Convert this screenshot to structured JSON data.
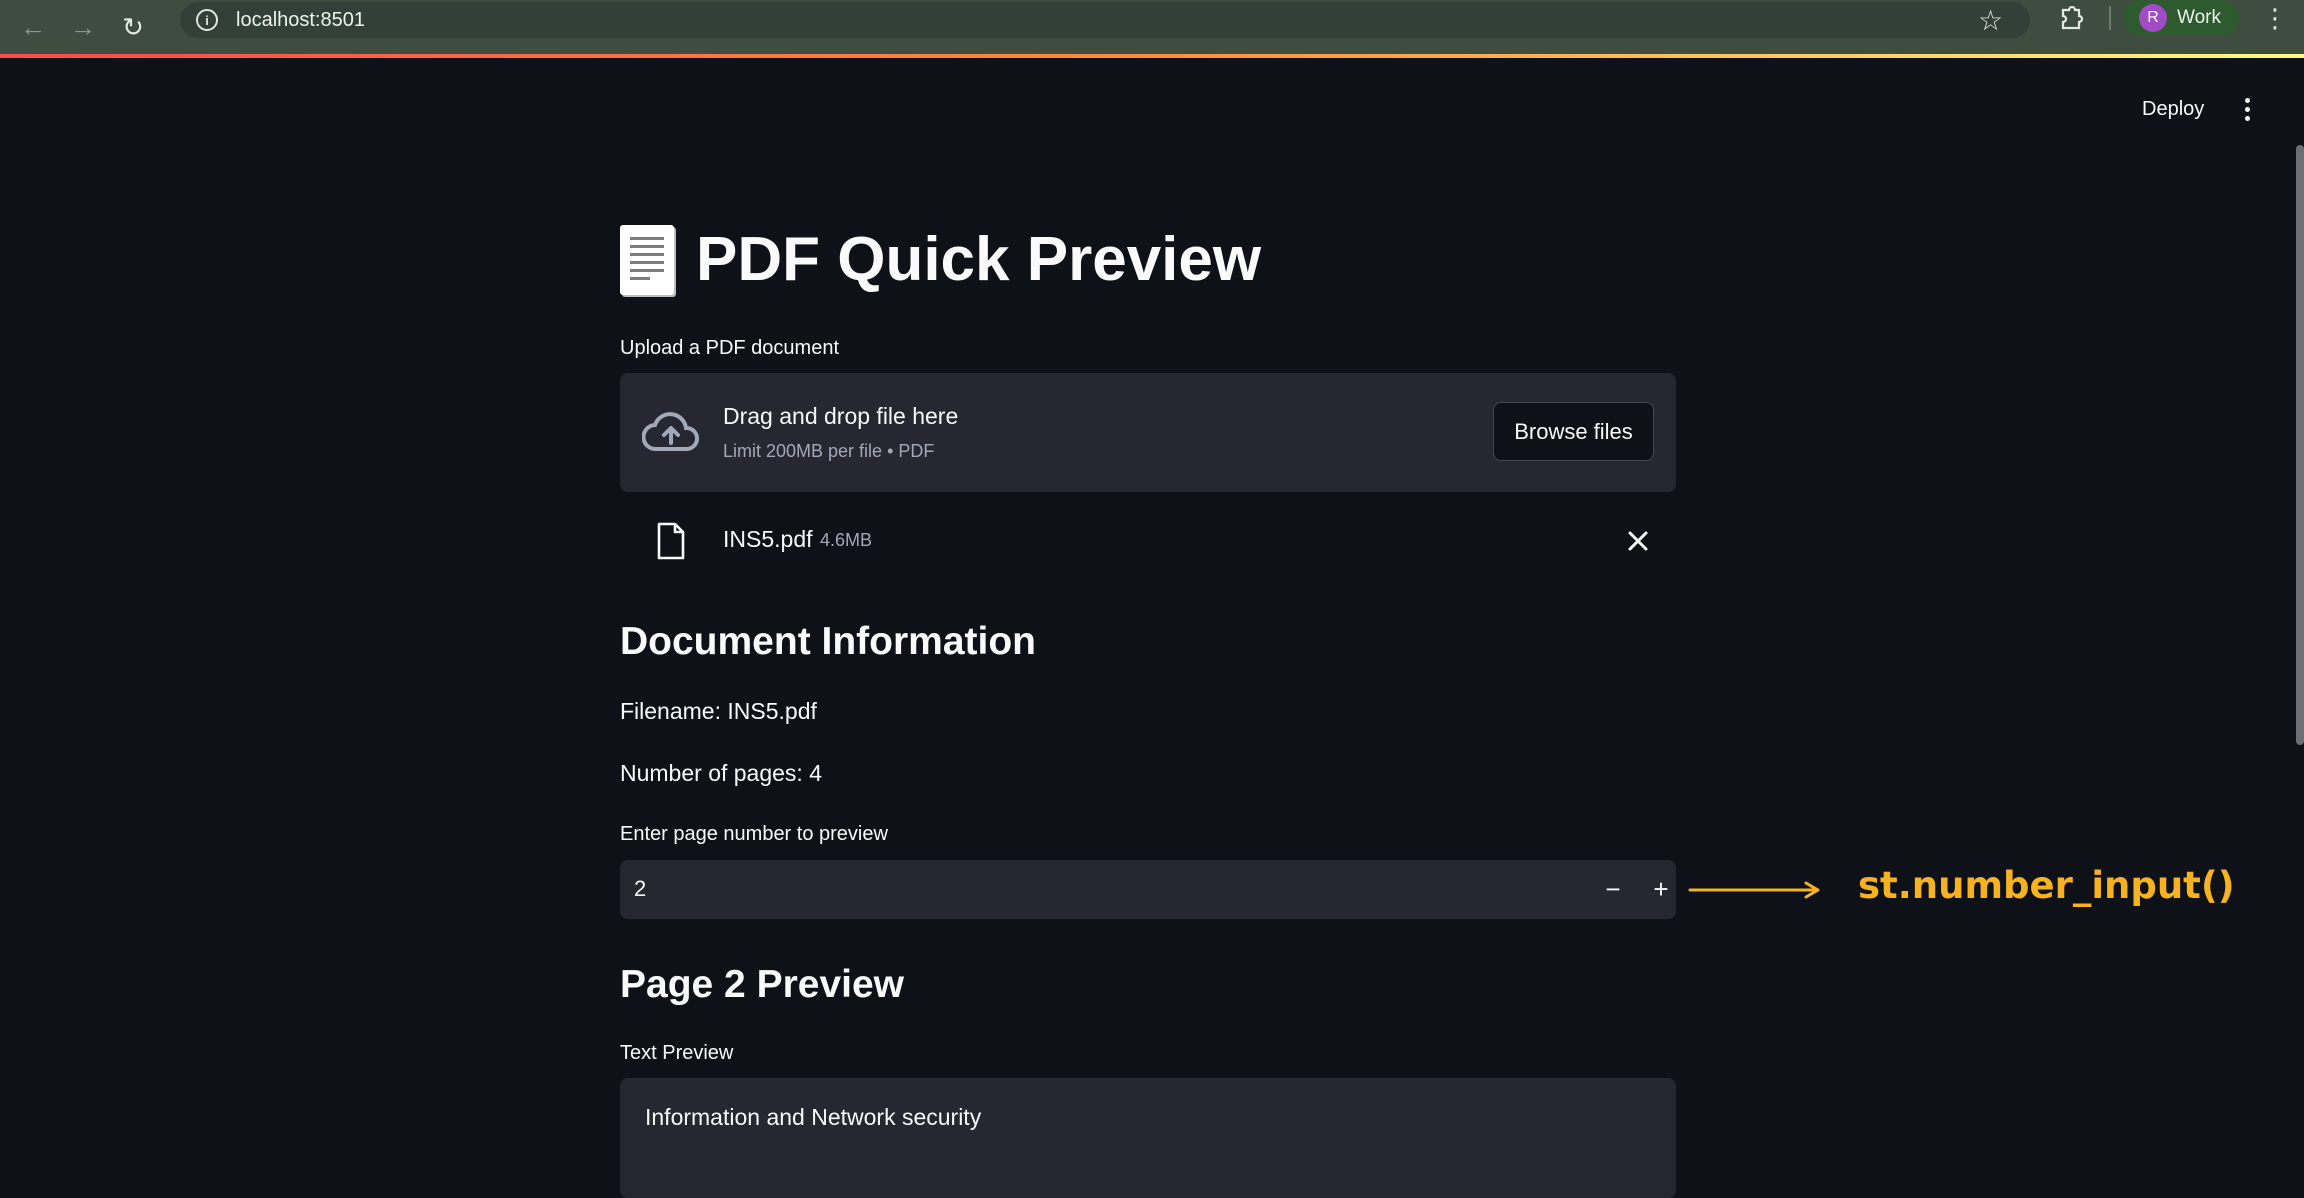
{
  "browser": {
    "url": "localhost:8501",
    "profile_initial": "R",
    "profile_name": "Work"
  },
  "header": {
    "deploy_label": "Deploy"
  },
  "page": {
    "title": "PDF Quick Preview",
    "uploader_label": "Upload a PDF document",
    "drop_title": "Drag and drop file here",
    "drop_limit": "Limit 200MB per file • PDF",
    "browse_label": "Browse files",
    "file_name": "INS5.pdf",
    "file_size": "4.6MB",
    "doc_info_heading": "Document Information",
    "filename_text": "Filename: INS5.pdf",
    "pages_text": "Number of pages: 4",
    "page_input_label": "Enter page number to preview",
    "page_input_value": "2",
    "preview_heading": "Page 2 Preview",
    "text_preview_label": "Text Preview",
    "text_preview_line1": "Information and Network security"
  },
  "annotation": {
    "label": "st.number_input()",
    "color": "#f7b21f"
  },
  "colors": {
    "background": "#0e1117",
    "widget_bg": "#262730",
    "browser_bar": "#3f4d40"
  }
}
